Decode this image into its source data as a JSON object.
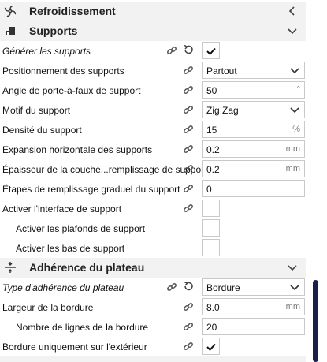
{
  "sections": {
    "cooling": {
      "title": "Refroidissement",
      "icon": "fan-icon",
      "state": "collapsed"
    },
    "supports": {
      "title": "Supports",
      "icon": "support-icon",
      "state": "expanded"
    },
    "adhesion": {
      "title": "Adhérence du plateau",
      "icon": "bed-adhesion-icon",
      "state": "expanded"
    }
  },
  "support_rows": {
    "generate": {
      "label": "Générer les supports",
      "checked": true
    },
    "placement": {
      "label": "Positionnement des supports",
      "value": "Partout"
    },
    "overhang_angle": {
      "label": "Angle de porte-à-faux de support",
      "value": "50",
      "unit": "°"
    },
    "pattern": {
      "label": "Motif du support",
      "value": "Zig Zag"
    },
    "density": {
      "label": "Densité du support",
      "value": "15",
      "unit": "%"
    },
    "horizontal_expansion": {
      "label": "Expansion horizontale des supports",
      "value": "0.2",
      "unit": "mm"
    },
    "infill_layer_thickness": {
      "label": "Épaisseur de la couche...remplissage de support",
      "value": "0.2",
      "unit": "mm"
    },
    "gradual_infill_steps": {
      "label": "Étapes de remplissage graduel du support",
      "value": "0"
    },
    "interface_enable": {
      "label": "Activer l'interface de support",
      "checked": false
    },
    "roof_enable": {
      "label": "Activer les plafonds de support",
      "checked": false
    },
    "bottom_enable": {
      "label": "Activer les bas de support",
      "checked": false
    }
  },
  "adhesion_rows": {
    "type": {
      "label": "Type d'adhérence du plateau",
      "value": "Bordure"
    },
    "brim_width": {
      "label": "Largeur de la bordure",
      "value": "8.0",
      "unit": "mm"
    },
    "brim_line_count": {
      "label": "Nombre de lignes de la bordure",
      "value": "20"
    },
    "brim_outside_only": {
      "label": "Bordure uniquement sur l'extérieur",
      "checked": true
    }
  },
  "colors": {
    "header_bg": "#f2f2f2",
    "scrollbar": "#1a1f4a",
    "border": "#c9c9c9"
  }
}
